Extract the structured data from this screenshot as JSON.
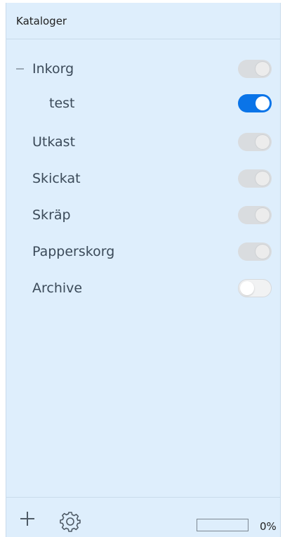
{
  "header": {
    "title": "Kataloger"
  },
  "folders": [
    {
      "label": "Inkorg",
      "collapse": true,
      "state": "off-disabled"
    },
    {
      "label": "test",
      "state": "on"
    },
    {
      "label": "Utkast",
      "state": "off-disabled"
    },
    {
      "label": "Skickat",
      "state": "off-disabled"
    },
    {
      "label": "Skräp",
      "state": "off-disabled"
    },
    {
      "label": "Papperskorg",
      "state": "off-disabled"
    },
    {
      "label": "Archive",
      "state": "off"
    }
  ],
  "footer": {
    "add_icon": "plus-icon",
    "settings_icon": "gear-icon",
    "progress_text": "0%",
    "progress_value": 0
  },
  "colors": {
    "panel_bg": "#deeefc",
    "accent": "#0a74e8"
  }
}
